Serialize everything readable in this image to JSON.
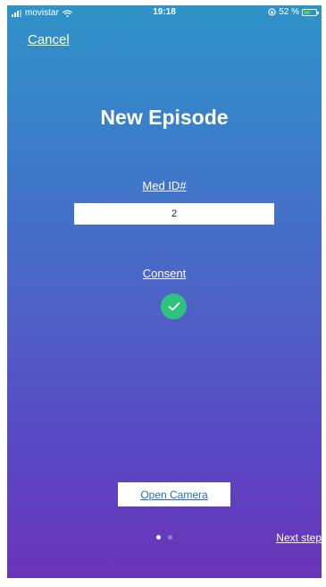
{
  "status_bar": {
    "carrier": "movistar",
    "time": "19:18",
    "battery_percent": "52 %",
    "battery_level": 0.52,
    "signal_bars": 3,
    "icons": [
      "signal-icon",
      "wifi-icon",
      "orientation-lock-icon",
      "battery-icon"
    ]
  },
  "header": {
    "cancel_label": "Cancel",
    "title": "New Episode"
  },
  "form": {
    "med_id_label": "Med ID#",
    "med_id_value": "2",
    "consent_label": "Consent",
    "consent_checked": true
  },
  "actions": {
    "open_camera_label": "Open Camera",
    "next_step_label": "Next step"
  },
  "pager": {
    "current_page": 1,
    "total_pages": 2
  },
  "colors": {
    "gradient_top": "#2f93c8",
    "gradient_bottom": "#6a34b8",
    "consent_green": "#2ec27e",
    "button_text_blue": "#1d6fb8",
    "battery_green": "#3cd46a"
  }
}
